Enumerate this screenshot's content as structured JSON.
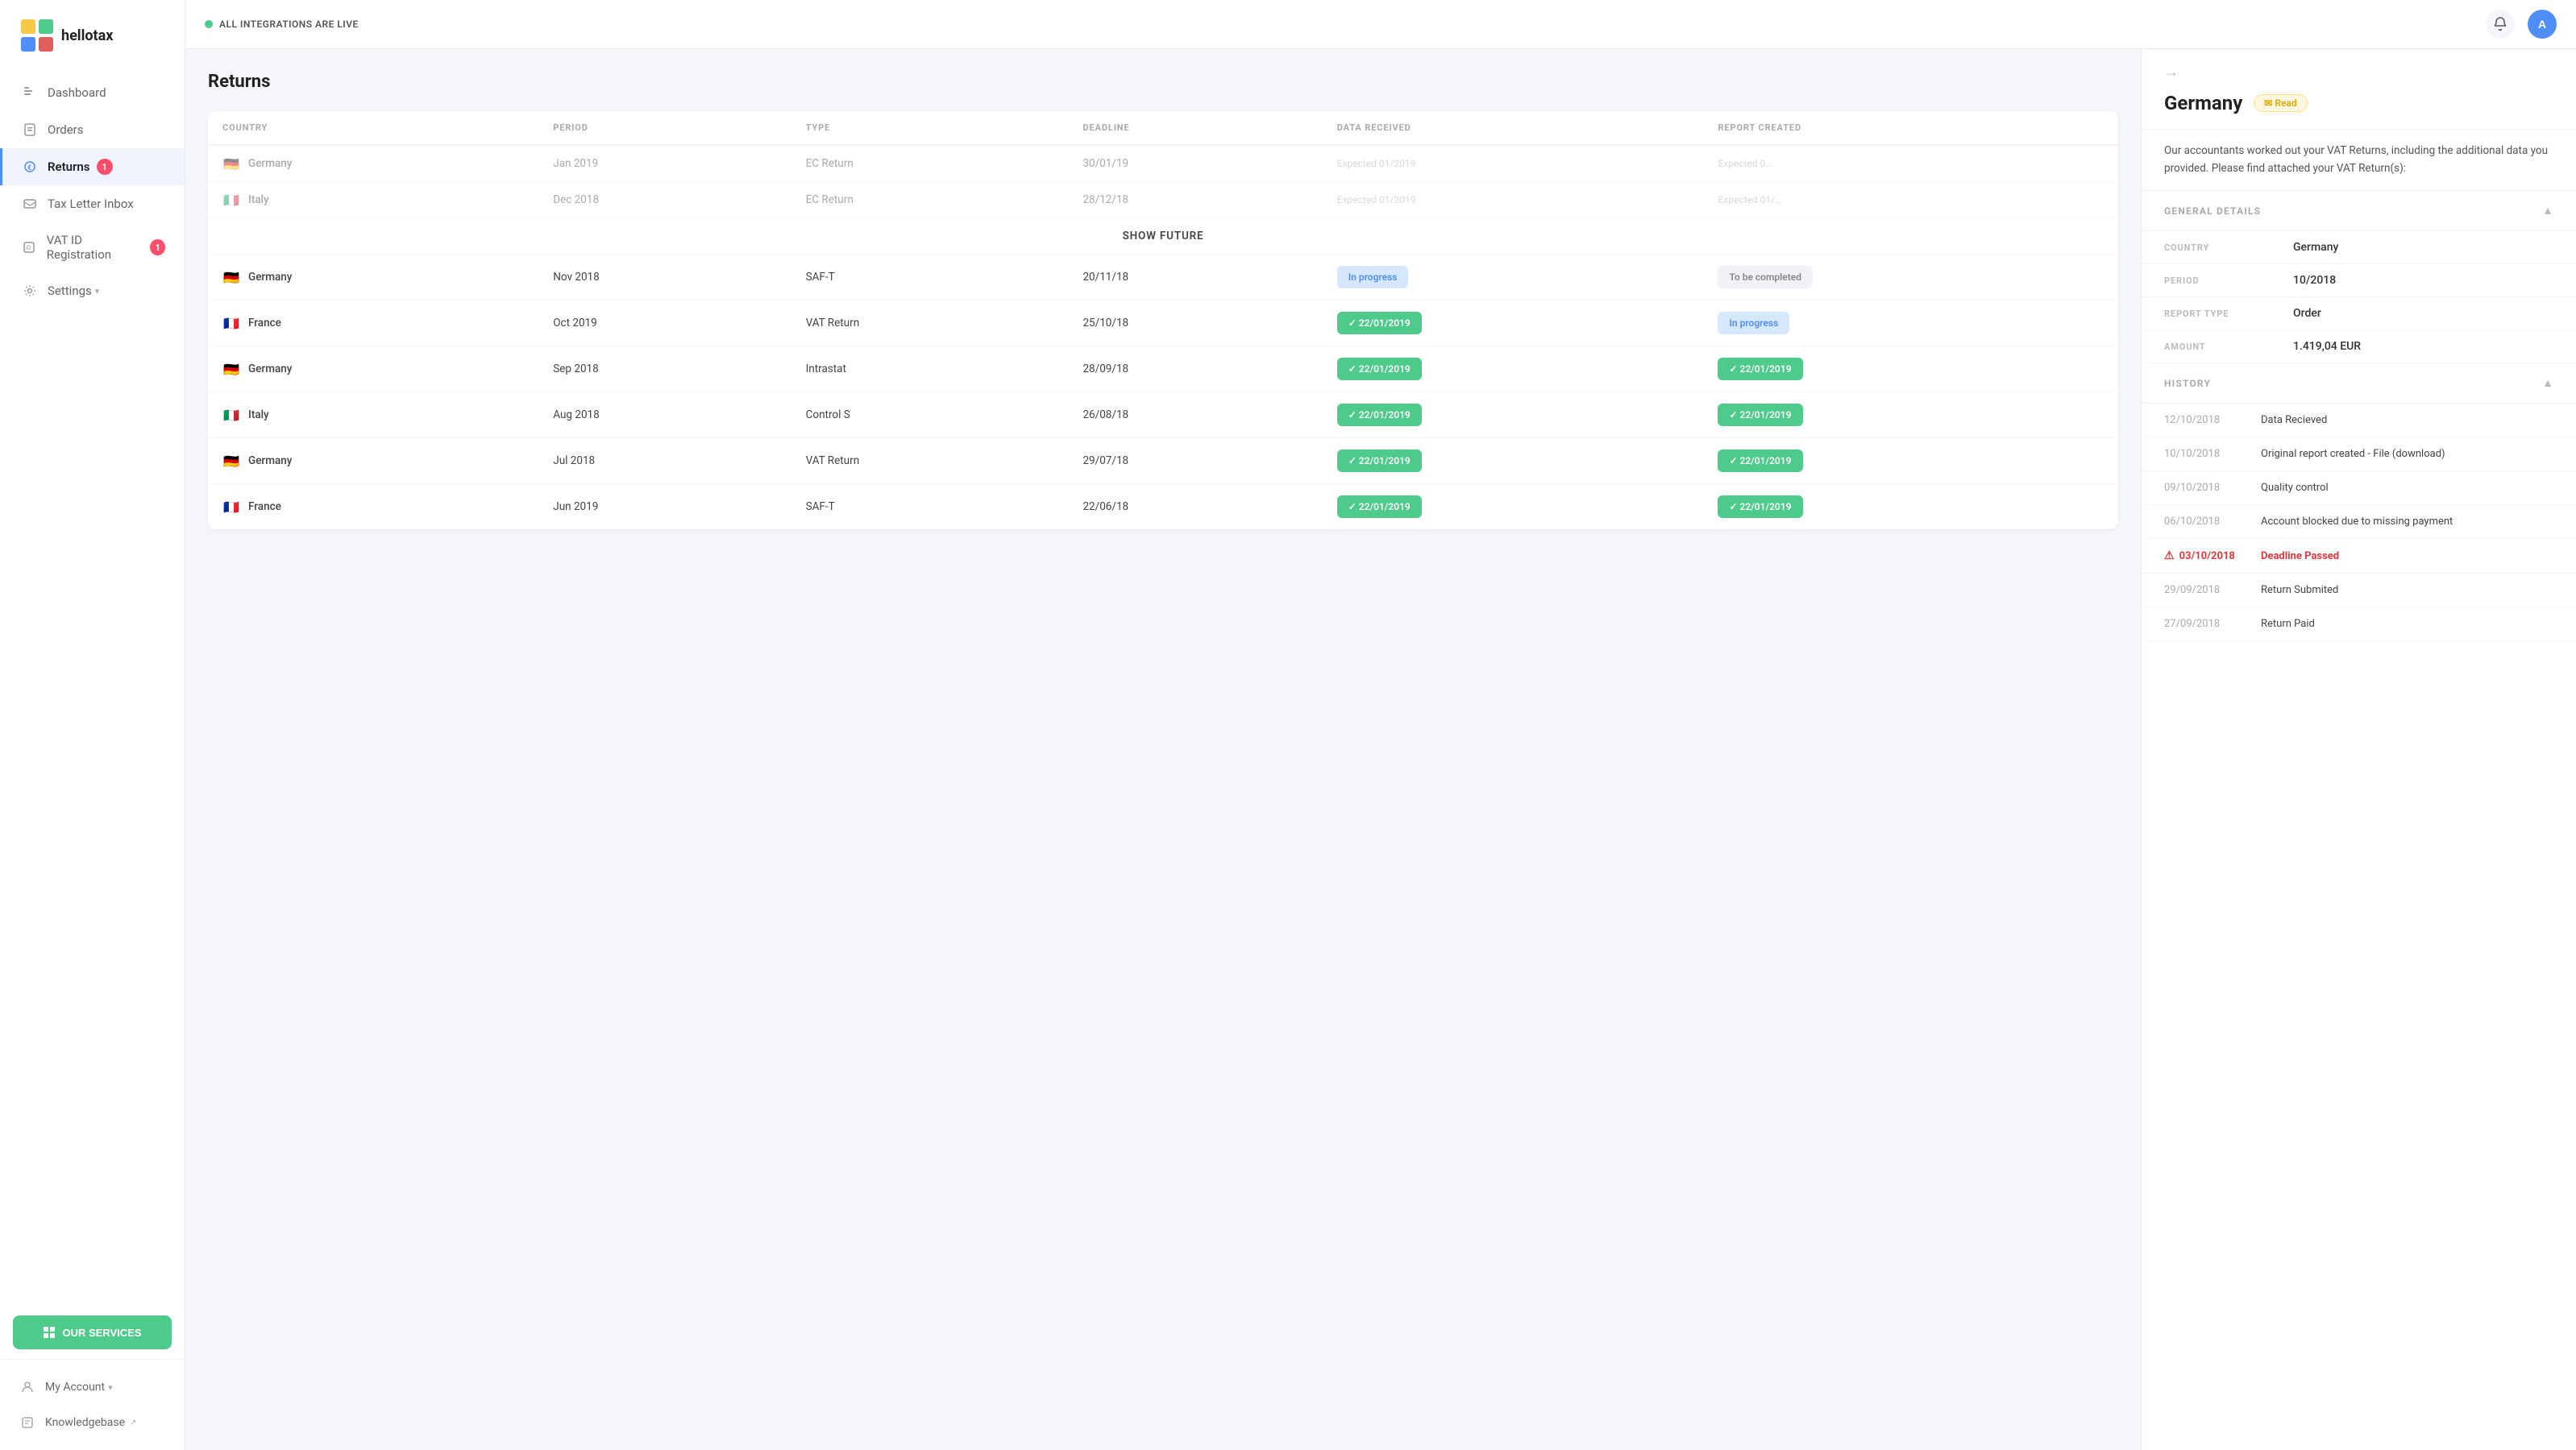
{
  "app": {
    "name": "hellotax"
  },
  "topbar": {
    "integration_status": "ALL INTEGRATIONS ARE LIVE",
    "avatar_label": "A"
  },
  "sidebar": {
    "nav_items": [
      {
        "id": "dashboard",
        "label": "Dashboard",
        "icon": "menu-icon",
        "active": false,
        "badge": null
      },
      {
        "id": "orders",
        "label": "Orders",
        "icon": "orders-icon",
        "active": false,
        "badge": null
      },
      {
        "id": "returns",
        "label": "Returns",
        "icon": "returns-icon",
        "active": true,
        "badge": "1"
      },
      {
        "id": "tax-letter-inbox",
        "label": "Tax Letter Inbox",
        "icon": "inbox-icon",
        "active": false,
        "badge": null
      },
      {
        "id": "vat-id-registration",
        "label": "VAT ID Registration",
        "icon": "vat-icon",
        "active": false,
        "badge": "1"
      },
      {
        "id": "settings",
        "label": "Settings",
        "icon": "settings-icon",
        "active": false,
        "badge": null
      }
    ],
    "our_services_label": "OUR SERVICES",
    "bottom_items": [
      {
        "id": "my-account",
        "label": "My Account",
        "icon": "account-icon"
      },
      {
        "id": "knowledgebase",
        "label": "Knowledgebase",
        "icon": "knowledge-icon"
      }
    ]
  },
  "returns": {
    "page_title": "Returns",
    "table_headers": [
      "COUNTRY",
      "PERIOD",
      "TYPE",
      "DEADLINE",
      "DATA RECEIVED",
      "REPORT CREATED"
    ],
    "show_future_label": "SHOW FUTURE",
    "rows": [
      {
        "country": "Germany",
        "flag": "🇩🇪",
        "period": "Jan 2019",
        "type": "EC Return",
        "deadline": "30/01/19",
        "data_received": "Expected 01/2019",
        "report_created": "Expected 0...",
        "faded": true
      },
      {
        "country": "Italy",
        "flag": "🇮🇹",
        "period": "Dec 2018",
        "type": "EC Return",
        "deadline": "28/12/18",
        "data_received": "Expected 01/2019",
        "report_created": "Expected 01/...",
        "faded": true
      },
      {
        "country": "Germany",
        "flag": "🇩🇪",
        "period": "Nov 2018",
        "type": "SAF-T",
        "deadline": "20/11/18",
        "data_received_status": "In progress",
        "data_received_type": "pill-blue",
        "report_created_status": "To be completed",
        "report_created_type": "pill-gray",
        "faded": false
      },
      {
        "country": "France",
        "flag": "🇫🇷",
        "period": "Oct 2019",
        "type": "VAT Return",
        "deadline": "25/10/18",
        "data_received_status": "✓ 22/01/2019",
        "data_received_type": "pill-green",
        "report_created_status": "In progress",
        "report_created_type": "pill-blue",
        "faded": false
      },
      {
        "country": "Germany",
        "flag": "🇩🇪",
        "period": "Sep 2018",
        "type": "Intrastat",
        "deadline": "28/09/18",
        "data_received_status": "✓ 22/01/2019",
        "data_received_type": "pill-green",
        "report_created_status": "✓ 22/01/2019",
        "report_created_type": "pill-green",
        "faded": false
      },
      {
        "country": "Italy",
        "flag": "🇮🇹",
        "period": "Aug 2018",
        "type": "Control S",
        "deadline": "26/08/18",
        "data_received_status": "✓ 22/01/2019",
        "data_received_type": "pill-green",
        "report_created_status": "✓ 22/01/2019",
        "report_created_type": "pill-green",
        "faded": false
      },
      {
        "country": "Germany",
        "flag": "🇩🇪",
        "period": "Jul 2018",
        "type": "VAT Return",
        "deadline": "29/07/18",
        "data_received_status": "✓ 22/01/2019",
        "data_received_type": "pill-green",
        "report_created_status": "✓ 22/01/2019",
        "report_created_type": "pill-green",
        "faded": false
      },
      {
        "country": "France",
        "flag": "🇫🇷",
        "period": "Jun 2019",
        "type": "SAF-T",
        "deadline": "22/06/18",
        "data_received_status": "✓ 22/01/2019",
        "data_received_type": "pill-green",
        "report_created_status": "✓ 22/01/2019",
        "report_created_type": "pill-green",
        "faded": false
      }
    ]
  },
  "detail_panel": {
    "back_arrow": "→",
    "title": "Germany",
    "read_badge": "✉ Read",
    "description": "Our accountants worked out your VAT Returns, including the additional data you provided. Please find attached your VAT Return(s):",
    "general_details": {
      "section_title": "GENERAL DETAILS",
      "fields": [
        {
          "label": "COUNTRY",
          "value": "Germany"
        },
        {
          "label": "PERIOD",
          "value": "10/2018"
        },
        {
          "label": "REPORT TYPE",
          "value": "Order"
        },
        {
          "label": "AMOUNT",
          "value": "1.419,04 EUR"
        }
      ]
    },
    "history": {
      "section_title": "HISTORY",
      "events": [
        {
          "date": "12/10/2018",
          "event": "Data Recieved",
          "alert": false
        },
        {
          "date": "10/10/2018",
          "event": "Original report created - File (download)",
          "alert": false
        },
        {
          "date": "09/10/2018",
          "event": "Quality control",
          "alert": false
        },
        {
          "date": "06/10/2018",
          "event": "Account blocked due to missing payment",
          "alert": false
        },
        {
          "date": "03/10/2018",
          "event": "Deadline Passed",
          "alert": true
        },
        {
          "date": "29/09/2018",
          "event": "Return Submited",
          "alert": false
        },
        {
          "date": "27/09/2018",
          "event": "Return Paid",
          "alert": false
        }
      ]
    }
  }
}
